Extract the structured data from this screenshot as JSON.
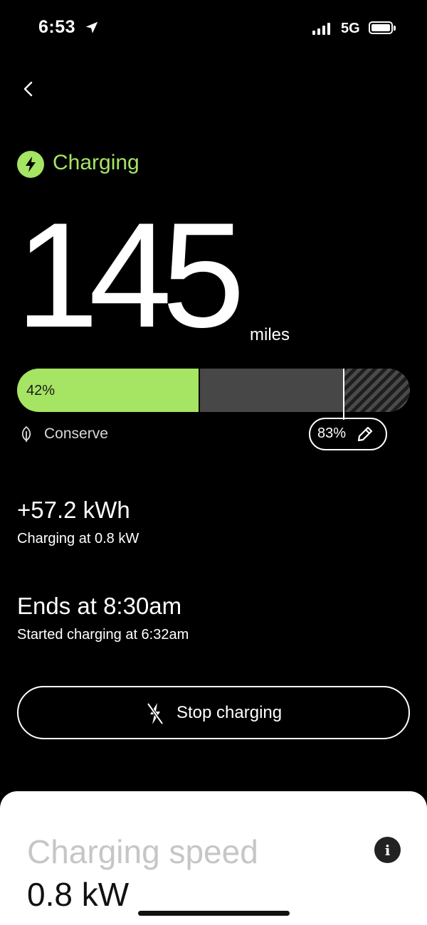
{
  "status_bar": {
    "time": "6:53",
    "network": "5G",
    "icons": [
      "location-arrow-icon",
      "signal-bars-icon",
      "battery-icon"
    ]
  },
  "header": {
    "back_icon": "chevron-left-icon"
  },
  "charging": {
    "status_label": "Charging",
    "status_icon": "lightning-bolt-icon",
    "range_value": "145",
    "range_unit": "miles",
    "soc_percent_label": "42%",
    "soc_fraction": 0.42,
    "limit_label": "83%",
    "limit_fraction": 0.83,
    "mode_icon": "leaf-icon",
    "mode_label": "Conserve",
    "edit_icon": "pencil-icon",
    "energy_added": "+57.2 kWh",
    "charging_rate": "Charging at 0.8 kW",
    "ends_at": "Ends at 8:30am",
    "started_at": "Started charging at 6:32am"
  },
  "actions": {
    "stop_label": "Stop charging",
    "stop_icon": "no-charge-bolt-icon"
  },
  "sheet": {
    "title": "Charging speed",
    "value": "0.8 kW",
    "info_icon": "info-icon",
    "info_glyph": "i"
  },
  "colors": {
    "accent": "#a6e463",
    "background": "#000000",
    "track": "#474747",
    "sheet": "#ffffff"
  }
}
